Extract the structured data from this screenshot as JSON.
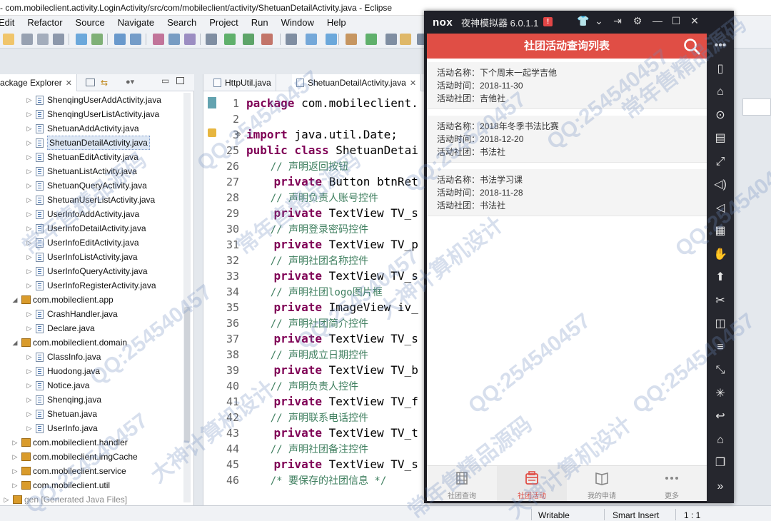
{
  "window": {
    "title": "- com.mobileclient.activity.LoginActivity/src/com/mobileclient/activity/ShetuanDetailActivity.java - Eclipse"
  },
  "menu": [
    "Edit",
    "Refactor",
    "Source",
    "Navigate",
    "Search",
    "Project",
    "Run",
    "Window",
    "Help"
  ],
  "package_explorer": {
    "tab_label": "ackage Explorer",
    "items": [
      {
        "label": "ShenqingUserAddActivity.java",
        "type": "file",
        "indent": 2
      },
      {
        "label": "ShenqingUserListActivity.java",
        "type": "file",
        "indent": 2
      },
      {
        "label": "ShetuanAddActivity.java",
        "type": "file",
        "indent": 2
      },
      {
        "label": "ShetuanDetailActivity.java",
        "type": "file",
        "indent": 2,
        "selected": true
      },
      {
        "label": "ShetuanEditActivity.java",
        "type": "file",
        "indent": 2
      },
      {
        "label": "ShetuanListActivity.java",
        "type": "file",
        "indent": 2
      },
      {
        "label": "ShetuanQueryActivity.java",
        "type": "file",
        "indent": 2
      },
      {
        "label": "ShetuanUserListActivity.java",
        "type": "file",
        "indent": 2
      },
      {
        "label": "UserInfoAddActivity.java",
        "type": "file",
        "indent": 2
      },
      {
        "label": "UserInfoDetailActivity.java",
        "type": "file",
        "indent": 2
      },
      {
        "label": "UserInfoEditActivity.java",
        "type": "file",
        "indent": 2
      },
      {
        "label": "UserInfoListActivity.java",
        "type": "file",
        "indent": 2
      },
      {
        "label": "UserInfoQueryActivity.java",
        "type": "file",
        "indent": 2
      },
      {
        "label": "UserInfoRegisterActivity.java",
        "type": "file",
        "indent": 2
      },
      {
        "label": "com.mobileclient.app",
        "type": "package",
        "indent": 1,
        "expanded": true
      },
      {
        "label": "CrashHandler.java",
        "type": "file",
        "indent": 2
      },
      {
        "label": "Declare.java",
        "type": "file",
        "indent": 2
      },
      {
        "label": "com.mobileclient.domain",
        "type": "package",
        "indent": 1,
        "expanded": true
      },
      {
        "label": "ClassInfo.java",
        "type": "file",
        "indent": 2
      },
      {
        "label": "Huodong.java",
        "type": "file",
        "indent": 2
      },
      {
        "label": "Notice.java",
        "type": "file",
        "indent": 2
      },
      {
        "label": "Shenqing.java",
        "type": "file",
        "indent": 2
      },
      {
        "label": "Shetuan.java",
        "type": "file",
        "indent": 2
      },
      {
        "label": "UserInfo.java",
        "type": "file",
        "indent": 2
      },
      {
        "label": "com.mobileclient.handler",
        "type": "package",
        "indent": 1
      },
      {
        "label": "com.mobileclient.imgCache",
        "type": "package",
        "indent": 1
      },
      {
        "label": "com.mobileclient.service",
        "type": "package",
        "indent": 1
      },
      {
        "label": "com.mobileclient.util",
        "type": "package",
        "indent": 1
      },
      {
        "label": "gen [Generated Java Files]",
        "type": "folder",
        "indent": 0
      }
    ]
  },
  "editor": {
    "tabs": [
      "HttpUtil.java",
      "ShetuanDetailActivity.java"
    ],
    "active_tab": 1,
    "lines": [
      {
        "n": "1",
        "parts": [
          {
            "t": "package ",
            "k": "kw"
          },
          {
            "t": "com.mobileclient.",
            "k": ""
          }
        ]
      },
      {
        "n": "2",
        "parts": []
      },
      {
        "n": "3",
        "parts": [
          {
            "t": "import ",
            "k": "kw"
          },
          {
            "t": "java.util.Date;",
            "k": ""
          }
        ],
        "fold": "⊕"
      },
      {
        "n": "25",
        "parts": [
          {
            "t": "public class ",
            "k": "kw"
          },
          {
            "t": "ShetuanDetai",
            "k": ""
          }
        ]
      },
      {
        "n": "26",
        "parts": [
          {
            "t": "    // 声明返回按钮",
            "k": "cm"
          }
        ]
      },
      {
        "n": "27",
        "parts": [
          {
            "t": "    private ",
            "k": "kw"
          },
          {
            "t": "Button btnRet",
            "k": ""
          }
        ]
      },
      {
        "n": "28",
        "parts": [
          {
            "t": "    // 声明负责人账号控件",
            "k": "cm"
          }
        ]
      },
      {
        "n": "29",
        "parts": [
          {
            "t": "    private ",
            "k": "kw"
          },
          {
            "t": "TextView TV_s",
            "k": ""
          }
        ]
      },
      {
        "n": "30",
        "parts": [
          {
            "t": "    // 声明登录密码控件",
            "k": "cm"
          }
        ]
      },
      {
        "n": "31",
        "parts": [
          {
            "t": "    private ",
            "k": "kw"
          },
          {
            "t": "TextView TV_p",
            "k": ""
          }
        ]
      },
      {
        "n": "32",
        "parts": [
          {
            "t": "    // 声明社团名称控件",
            "k": "cm"
          }
        ]
      },
      {
        "n": "33",
        "parts": [
          {
            "t": "    private ",
            "k": "kw"
          },
          {
            "t": "TextView TV_s",
            "k": ""
          }
        ]
      },
      {
        "n": "34",
        "parts": [
          {
            "t": "    // 声明社团logo图片框",
            "k": "cm"
          }
        ]
      },
      {
        "n": "35",
        "parts": [
          {
            "t": "    private ",
            "k": "kw"
          },
          {
            "t": "ImageView iv_",
            "k": ""
          }
        ]
      },
      {
        "n": "36",
        "parts": [
          {
            "t": "    // 声明社团简介控件",
            "k": "cm"
          }
        ]
      },
      {
        "n": "37",
        "parts": [
          {
            "t": "    private ",
            "k": "kw"
          },
          {
            "t": "TextView TV_s",
            "k": ""
          }
        ]
      },
      {
        "n": "38",
        "parts": [
          {
            "t": "    // 声明成立日期控件",
            "k": "cm"
          }
        ]
      },
      {
        "n": "39",
        "parts": [
          {
            "t": "    private ",
            "k": "kw"
          },
          {
            "t": "TextView TV_b",
            "k": ""
          }
        ]
      },
      {
        "n": "40",
        "parts": [
          {
            "t": "    // 声明负责人控件",
            "k": "cm"
          }
        ]
      },
      {
        "n": "41",
        "parts": [
          {
            "t": "    private ",
            "k": "kw"
          },
          {
            "t": "TextView TV_f",
            "k": ""
          }
        ]
      },
      {
        "n": "42",
        "parts": [
          {
            "t": "    // 声明联系电话控件",
            "k": "cm"
          }
        ]
      },
      {
        "n": "43",
        "parts": [
          {
            "t": "    private ",
            "k": "kw"
          },
          {
            "t": "TextView TV_t",
            "k": ""
          }
        ]
      },
      {
        "n": "44",
        "parts": [
          {
            "t": "    // 声明社团备注控件",
            "k": "cm"
          }
        ]
      },
      {
        "n": "45",
        "parts": [
          {
            "t": "    private ",
            "k": "kw"
          },
          {
            "t": "TextView TV_s",
            "k": ""
          }
        ]
      },
      {
        "n": "46",
        "parts": [
          {
            "t": "    /* 要保存的社团信息 */",
            "k": "cm"
          }
        ]
      }
    ]
  },
  "statusbar": {
    "writable": "Writable",
    "insert_mode": "Smart Insert",
    "position": "1 : 1"
  },
  "emulator": {
    "logo": "nox",
    "name": "夜神模拟器 6.0.1.1",
    "alert": "!",
    "app": {
      "title": "社团活动查询列表",
      "activities": [
        {
          "name_label": "活动名称：",
          "name": "下个周末一起学吉他",
          "time_label": "活动时间：",
          "time": "2018-11-30",
          "club_label": "活动社团：",
          "club": "吉他社"
        },
        {
          "name_label": "活动名称：",
          "name": "2018年冬季书法比赛",
          "time_label": "活动时间：",
          "time": "2018-12-20",
          "club_label": "活动社团：",
          "club": "书法社"
        },
        {
          "name_label": "活动名称：",
          "name": "书法学习课",
          "time_label": "活动时间：",
          "time": "2018-11-28",
          "club_label": "活动社团：",
          "club": "书法社"
        }
      ],
      "nav": [
        {
          "label": "社团查询",
          "icon": "film-icon"
        },
        {
          "label": "社团活动",
          "icon": "calendar-icon",
          "active": true
        },
        {
          "label": "我的申请",
          "icon": "book-icon"
        },
        {
          "label": "更多",
          "icon": "more-icon"
        }
      ]
    }
  },
  "watermarks": [
    "QQ:254540457",
    "大神计算机设计",
    "常年售精品源码"
  ],
  "colors": {
    "app_accent": "#e04e45",
    "keyword": "#7f0055",
    "comment": "#3f7f5f"
  }
}
